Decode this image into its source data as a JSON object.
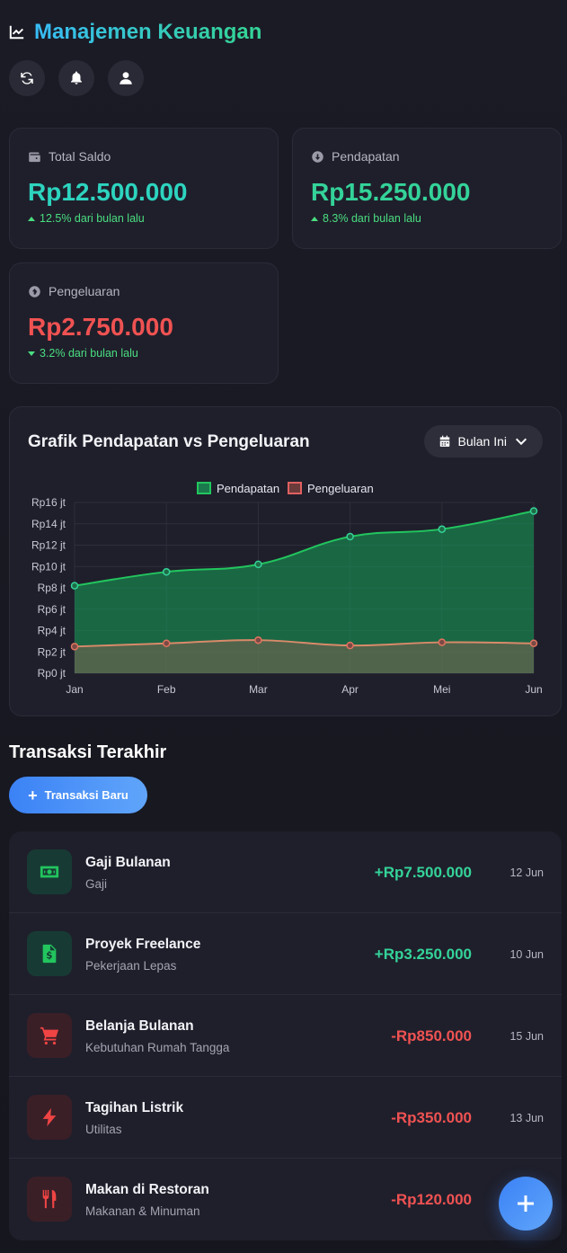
{
  "header": {
    "title": "Manajemen Keuangan",
    "logo_icon": "chart-line-icon",
    "actions": [
      "refresh-icon",
      "bell-icon",
      "user-icon"
    ]
  },
  "stats": {
    "balance": {
      "label": "Total Saldo",
      "value": "Rp12.500.000",
      "trend": "12.5% dari bulan lalu",
      "icon": "wallet-icon",
      "color": "#2dd4bf"
    },
    "income": {
      "label": "Pendapatan",
      "value": "Rp15.250.000",
      "trend": "8.3% dari bulan lalu",
      "icon": "arrow-down-circle-icon",
      "color": "#34d399"
    },
    "expense": {
      "label": "Pengeluaran",
      "value": "Rp2.750.000",
      "trend": "3.2% dari bulan lalu",
      "icon": "arrow-up-circle-icon",
      "color": "#f05252"
    }
  },
  "chart_section": {
    "title": "Grafik Pendapatan vs Pengeluaran",
    "period_label": "Bulan Ini"
  },
  "chart_data": {
    "type": "area",
    "categories": [
      "Jan",
      "Feb",
      "Mar",
      "Apr",
      "Mei",
      "Jun"
    ],
    "y_tick_labels": [
      "Rp0 jt",
      "Rp2 jt",
      "Rp4 jt",
      "Rp6 jt",
      "Rp8 jt",
      "Rp10 jt",
      "Rp12 jt",
      "Rp14 jt",
      "Rp16 jt"
    ],
    "ylim": [
      0,
      16
    ],
    "grid": true,
    "legend_position": "top",
    "series": [
      {
        "name": "Pendapatan",
        "color": "#22c55e",
        "values": [
          8.2,
          9.5,
          10.2,
          12.8,
          13.5,
          15.2
        ]
      },
      {
        "name": "Pengeluaran",
        "color": "#e06060",
        "values": [
          2.5,
          2.8,
          3.1,
          2.6,
          2.9,
          2.8
        ]
      }
    ]
  },
  "transactions": {
    "title": "Transaksi Terakhir",
    "new_button": "Transaksi Baru",
    "items": [
      {
        "name": "Gaji Bulanan",
        "category": "Gaji",
        "amount": "+Rp7.500.000",
        "date": "12 Jun",
        "type": "in",
        "icon": "money-bill-icon"
      },
      {
        "name": "Proyek Freelance",
        "category": "Pekerjaan Lepas",
        "amount": "+Rp3.250.000",
        "date": "10 Jun",
        "type": "in",
        "icon": "invoice-dollar-icon"
      },
      {
        "name": "Belanja Bulanan",
        "category": "Kebutuhan Rumah Tangga",
        "amount": "-Rp850.000",
        "date": "15 Jun",
        "type": "out",
        "icon": "shopping-cart-icon"
      },
      {
        "name": "Tagihan Listrik",
        "category": "Utilitas",
        "amount": "-Rp350.000",
        "date": "13 Jun",
        "type": "out",
        "icon": "bolt-icon"
      },
      {
        "name": "Makan di Restoran",
        "category": "Makanan & Minuman",
        "amount": "-Rp120.000",
        "date": "",
        "type": "out",
        "icon": "utensils-icon"
      }
    ]
  }
}
